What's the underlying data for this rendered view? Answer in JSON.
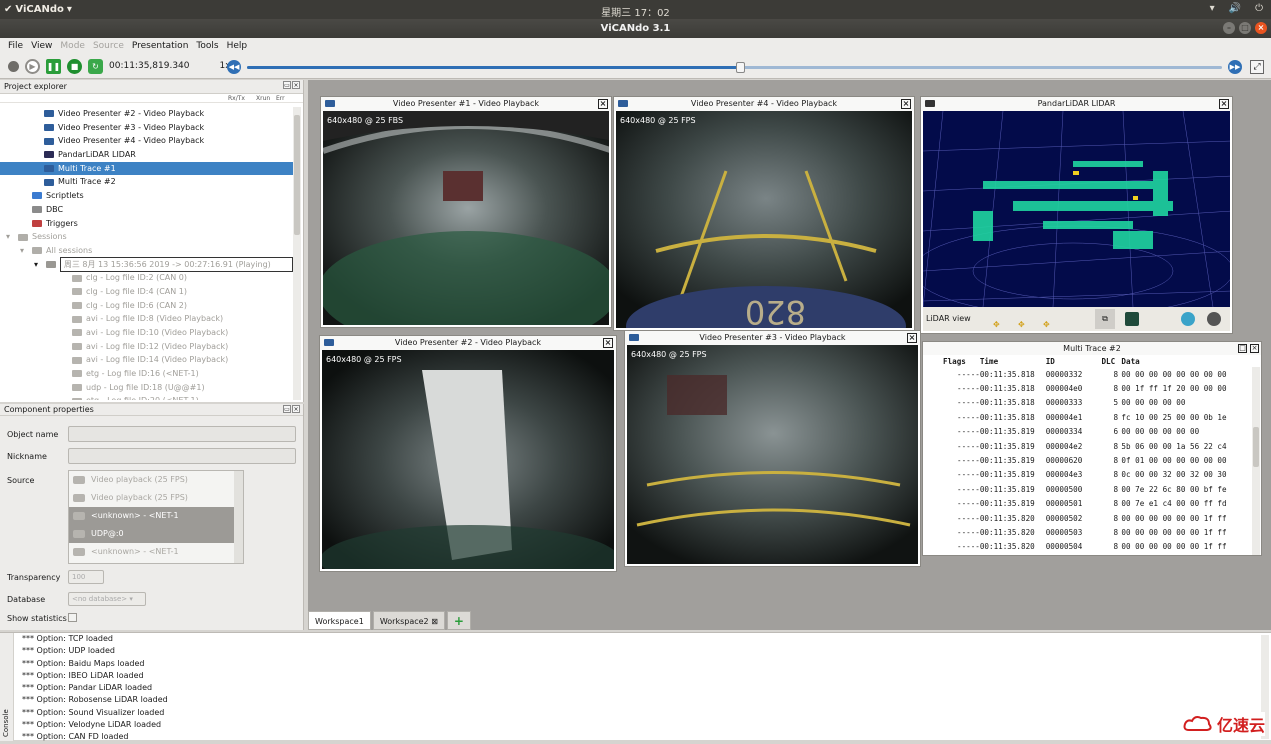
{
  "topbar": {
    "app_name": "ViCANdo",
    "clock": "星期三 17：02"
  },
  "window": {
    "title": "ViCANdo 3.1"
  },
  "menu": [
    {
      "label": "File",
      "enabled": true
    },
    {
      "label": "View",
      "enabled": true
    },
    {
      "label": "Mode",
      "enabled": false
    },
    {
      "label": "Source",
      "enabled": false
    },
    {
      "label": "Presentation",
      "enabled": true
    },
    {
      "label": "Tools",
      "enabled": true
    },
    {
      "label": "Help",
      "enabled": true
    }
  ],
  "toolbar": {
    "time": "00:11:35,819.340",
    "speed": "1x",
    "progress": 0.506
  },
  "explorer": {
    "title": "Project explorer",
    "columns": [
      "Rx/Tx",
      "Xrun",
      "Err"
    ],
    "items": [
      {
        "label": "Video Presenter #2 - Video Playback",
        "indent": 44,
        "icon": "monitor-icon",
        "state": "normal"
      },
      {
        "label": "Video Presenter #3 - Video Playback",
        "indent": 44,
        "icon": "monitor-icon",
        "state": "normal"
      },
      {
        "label": "Video Presenter #4 - Video Playback",
        "indent": 44,
        "icon": "monitor-icon",
        "state": "normal"
      },
      {
        "label": "PandarLiDAR LIDAR",
        "indent": 44,
        "icon": "lidar-icon",
        "state": "normal"
      },
      {
        "label": "Multi Trace #1",
        "indent": 44,
        "icon": "monitor-icon",
        "state": "selected"
      },
      {
        "label": "Multi Trace #2",
        "indent": 44,
        "icon": "monitor-icon",
        "state": "normal"
      },
      {
        "label": "Scriptlets",
        "indent": 32,
        "icon": "script-icon",
        "state": "normal"
      },
      {
        "label": "DBC",
        "indent": 32,
        "icon": "dbc-icon",
        "state": "normal"
      },
      {
        "label": "Triggers",
        "indent": 32,
        "icon": "trigger-icon",
        "state": "normal"
      },
      {
        "label": "Sessions",
        "indent": 18,
        "icon": "gear-icon",
        "state": "grey",
        "arrow": "▾"
      },
      {
        "label": "All sessions",
        "indent": 32,
        "icon": "folder-icon",
        "state": "grey",
        "arrow": "▾"
      },
      {
        "label": "周三 8月 13 15:36:56 2019 -> 00:27:16.91 (Playing)",
        "indent": 46,
        "icon": "session-icon",
        "state": "boxed",
        "arrow": "▾"
      },
      {
        "label": "clg - Log file ID:2 (CAN 0)",
        "indent": 72,
        "icon": "log-icon",
        "state": "grey"
      },
      {
        "label": "clg - Log file ID:4 (CAN 1)",
        "indent": 72,
        "icon": "log-icon",
        "state": "grey"
      },
      {
        "label": "clg - Log file ID:6 (CAN 2)",
        "indent": 72,
        "icon": "log-icon",
        "state": "grey"
      },
      {
        "label": "avi - Log file ID:8 (Video Playback)",
        "indent": 72,
        "icon": "video-icon",
        "state": "grey"
      },
      {
        "label": "avi - Log file ID:10 (Video Playback)",
        "indent": 72,
        "icon": "video-icon",
        "state": "grey"
      },
      {
        "label": "avi - Log file ID:12 (Video Playback)",
        "indent": 72,
        "icon": "video-icon",
        "state": "grey"
      },
      {
        "label": "avi - Log file ID:14 (Video Playback)",
        "indent": 72,
        "icon": "video-icon",
        "state": "grey"
      },
      {
        "label": "etg - Log file ID:16 (<NET-1)",
        "indent": 72,
        "icon": "net-icon",
        "state": "grey"
      },
      {
        "label": "udp - Log file ID:18 (U@@#1)",
        "indent": 72,
        "icon": "net-icon",
        "state": "grey"
      },
      {
        "label": "etg - Log file ID:20 (<NET-1)",
        "indent": 72,
        "icon": "net-icon",
        "state": "grey"
      }
    ]
  },
  "properties": {
    "title": "Component properties",
    "object_name_label": "Object name",
    "nickname_label": "Nickname",
    "source_label": "Source",
    "sources": [
      {
        "label": "Video playback (25 FPS)",
        "selected": false
      },
      {
        "label": "Video playback (25 FPS)",
        "selected": false
      },
      {
        "label": "<unknown> - <NET-1",
        "selected": true
      },
      {
        "label": "UDP@:0",
        "selected": true
      },
      {
        "label": "<unknown> - <NET-1",
        "selected": false
      }
    ],
    "transparency_label": "Transparency",
    "transparency_value": "100",
    "database_label": "Database",
    "database_value": "<no database>",
    "stats_label": "Show statistics"
  },
  "views": {
    "vp1": {
      "title": "Video Presenter #1 - Video Playback",
      "fps": "640x480 @ 25 FBS"
    },
    "vp4": {
      "title": "Video Presenter #4 - Video Playback",
      "fps": "640x480 @ 25 FPS"
    },
    "lidar": {
      "title": "PandarLiDAR LIDAR",
      "toolbar_label": "LiDAR view"
    },
    "vp2": {
      "title": "Video Presenter #2 - Video Playback",
      "fps": "640x480 @ 25 FPS"
    },
    "vp3": {
      "title": "Video Presenter #3 - Video Playback",
      "fps": "640x480 @ 25 FPS"
    }
  },
  "trace": {
    "title": "Multi Trace #2",
    "columns": [
      "Flags",
      "Time",
      "ID",
      "DLC",
      "Data"
    ],
    "rows": [
      [
        "-----",
        "00:11:35.818",
        "00000332",
        "8",
        "00 00 00 00 00 00 00 00"
      ],
      [
        "-----",
        "00:11:35.818",
        "000004e0",
        "8",
        "00 1f ff 1f 20 00 00 00"
      ],
      [
        "-----",
        "00:11:35.818",
        "00000333",
        "5",
        "00 00 00 00 00"
      ],
      [
        "-----",
        "00:11:35.818",
        "000004e1",
        "8",
        "fc 10 00 25 00 00 0b 1e"
      ],
      [
        "-----",
        "00:11:35.819",
        "00000334",
        "6",
        "00 00 00 00 00 00"
      ],
      [
        "-----",
        "00:11:35.819",
        "000004e2",
        "8",
        "5b 06 00 00 1a 56 22 c4"
      ],
      [
        "-----",
        "00:11:35.819",
        "00000620",
        "8",
        "0f 01 00 00 00 00 00 00"
      ],
      [
        "-----",
        "00:11:35.819",
        "000004e3",
        "8",
        "0c 00 00 32 00 32 00 30"
      ],
      [
        "-----",
        "00:11:35.819",
        "00000500",
        "8",
        "00 7e 22 6c 80 00 bf fe"
      ],
      [
        "-----",
        "00:11:35.819",
        "00000501",
        "8",
        "00 7e e1 c4 00 00 ff fd"
      ],
      [
        "-----",
        "00:11:35.820",
        "00000502",
        "8",
        "00 00 00 00 00 00 1f ff"
      ],
      [
        "-----",
        "00:11:35.820",
        "00000503",
        "8",
        "00 00 00 00 00 00 1f ff"
      ],
      [
        "-----",
        "00:11:35.820",
        "00000504",
        "8",
        "00 00 00 00 00 00 1f ff"
      ]
    ]
  },
  "tabs": [
    {
      "label": "Workspace1",
      "active": true
    },
    {
      "label": "Workspace2",
      "active": false,
      "closable": true
    }
  ],
  "console": {
    "label": "Console",
    "lines": [
      "*** Option: TCP loaded",
      "*** Option: UDP loaded",
      "*** Option: Baidu Maps loaded",
      "*** Option: IBEO LiDAR loaded",
      "*** Option: Pandar LiDAR loaded",
      "*** Option: Robosense LiDAR loaded",
      "*** Option: Sound Visualizer loaded",
      "*** Option: Velodyne LiDAR loaded",
      "*** Option: CAN FD loaded"
    ]
  },
  "watermark": {
    "text": "亿速云"
  }
}
